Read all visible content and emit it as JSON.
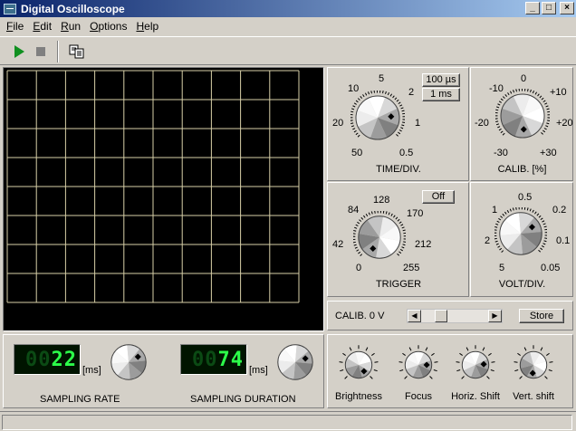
{
  "window": {
    "title": "Digital Oscilloscope",
    "minimize": "_",
    "maximize": "□",
    "close": "×"
  },
  "menu": [
    {
      "key": "F",
      "rest": "ile"
    },
    {
      "key": "E",
      "rest": "dit"
    },
    {
      "key": "R",
      "rest": "un"
    },
    {
      "key": "O",
      "rest": "ptions"
    },
    {
      "key": "H",
      "rest": "elp"
    }
  ],
  "toolbar": {
    "run": "play-icon",
    "stop": "stop-icon",
    "copy": "copy-icon"
  },
  "time_div": {
    "label": "TIME/DIV.",
    "scale": [
      "50",
      "20",
      "10",
      "5",
      "2",
      "1",
      "0.5"
    ],
    "unit_buttons": [
      "100 µs",
      "1 ms"
    ]
  },
  "calib": {
    "label": "CALIB. [%]",
    "scale": [
      "-30",
      "-20",
      "-10",
      "0",
      "+10",
      "+20",
      "+30"
    ]
  },
  "trigger": {
    "label": "TRIGGER",
    "off_button": "Off",
    "scale": [
      "0",
      "42",
      "84",
      "128",
      "170",
      "212",
      "255"
    ]
  },
  "volt_div": {
    "label": "VOLT/DIV.",
    "scale": [
      "5",
      "2",
      "1",
      "0.5",
      "0.2",
      "0.1",
      "0.05"
    ]
  },
  "calib0v": {
    "label": "CALIB. 0 V",
    "store": "Store",
    "left_arrow": "◀",
    "right_arrow": "▶"
  },
  "sampling_rate": {
    "label": "SAMPLING RATE",
    "unit": "[ms]",
    "digits_dim": "00",
    "digits": "22"
  },
  "sampling_duration": {
    "label": "SAMPLING DURATION",
    "unit": "[ms]",
    "digits_dim": "00",
    "digits": "74"
  },
  "small_knobs": [
    {
      "label": "Brightness"
    },
    {
      "label": "Focus"
    },
    {
      "label": "Horiz. Shift"
    },
    {
      "label": "Vert. shift"
    }
  ],
  "colors": {
    "grid": "#d8d0a8",
    "lcd": "#2cff4a",
    "title_start": "#0a246a",
    "title_end": "#a6caf0"
  }
}
